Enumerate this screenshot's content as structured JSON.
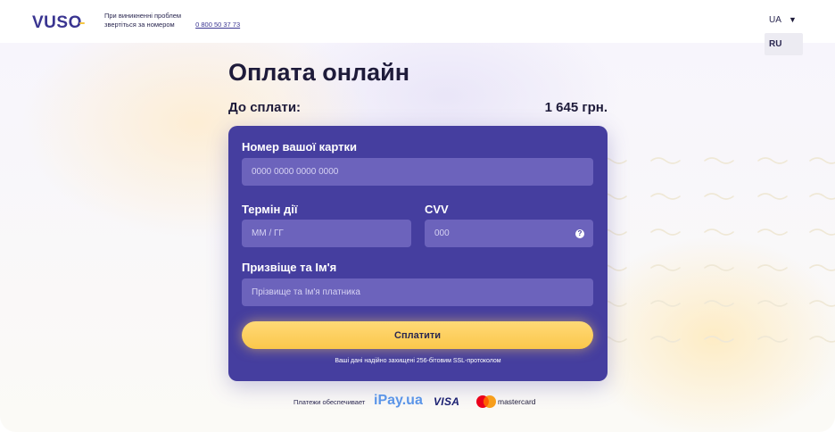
{
  "header": {
    "logo": "VUSO",
    "support_text": "При виникненні проблем звертіться за номером",
    "support_phone": "0 800 50 37 73",
    "lang_current": "UA",
    "lang_options": [
      "RU"
    ]
  },
  "main": {
    "title": "Оплата онлайн",
    "due_label": "До сплати:",
    "due_amount": "1 645 грн."
  },
  "form": {
    "card_number_label": "Номер вашої картки",
    "card_number_placeholder": "0000 0000 0000 0000",
    "expiry_label": "Термін дії",
    "expiry_placeholder": "ММ / ГГ",
    "cvv_label": "CVV",
    "cvv_placeholder": "000",
    "name_label": "Призвіще та Ім'я",
    "name_placeholder": "Прізвище та Ім'я платника",
    "submit_label": "Сплатити",
    "ssl_note": "Ваші дані надійно захищені 256-бітовим SSL-протоколом"
  },
  "footer": {
    "provider_label": "Платежи обеспечивает",
    "provider_name": "iPay.ua",
    "visa_label": "VISA",
    "mastercard_label": "mastercard"
  },
  "colors": {
    "brand_purple": "#453e9f",
    "button_yellow": "#fbc74b",
    "field_purple": "#6c63bc"
  },
  "icons": {
    "cvv_help": "question-circle-icon",
    "lang_toggle": "triangle-down-icon",
    "mastercard": "mastercard-circles-icon"
  }
}
